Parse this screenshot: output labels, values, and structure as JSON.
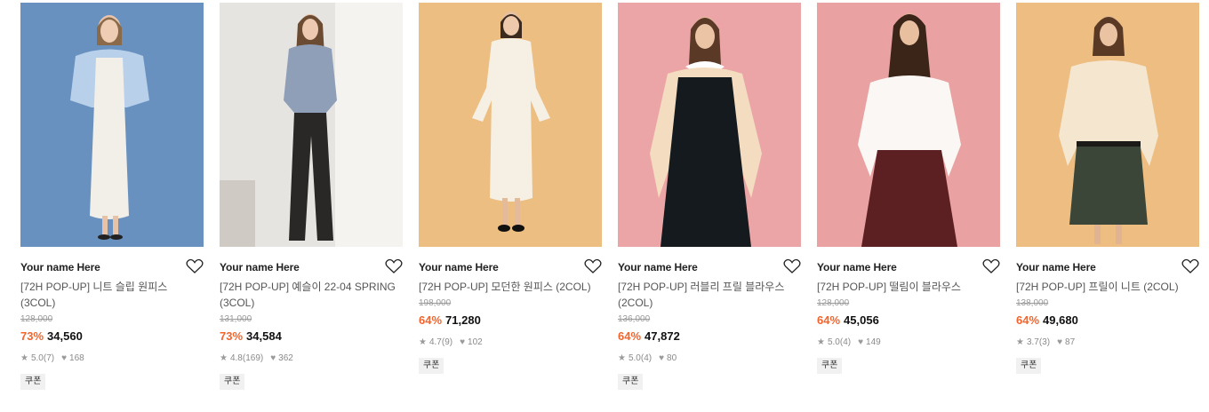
{
  "products": [
    {
      "brand": "Your name Here",
      "title": "[72H POP-UP] 니트 슬립 원피스 (3COL)",
      "original_price": "128,000",
      "discount": "73%",
      "price": "34,560",
      "rating": "5.0",
      "reviews": "(7)",
      "likes": "168",
      "coupon": "쿠폰",
      "bg_color": "#6f97c4",
      "wish_icon": "heart-outline-icon"
    },
    {
      "brand": "Your name Here",
      "title": "[72H POP-UP] 예슬이 22-04 SPRING (3COL)",
      "original_price": "131,000",
      "discount": "73%",
      "price": "34,584",
      "rating": "4.8",
      "reviews": "(169)",
      "likes": "362",
      "coupon": "쿠폰",
      "bg_color": "#e6e4e0",
      "wish_icon": "heart-outline-icon"
    },
    {
      "brand": "Your name Here",
      "title": "[72H POP-UP] 모던한 원피스 (2COL)",
      "original_price": "198,000",
      "discount": "64%",
      "price": "71,280",
      "rating": "4.7",
      "reviews": "(9)",
      "likes": "102",
      "coupon": "쿠폰",
      "bg_color": "#edbe82",
      "wish_icon": "heart-outline-icon"
    },
    {
      "brand": "Your name Here",
      "title": "[72H POP-UP] 러블리 프릴 블라우스 (2COL)",
      "original_price": "136,000",
      "discount": "64%",
      "price": "47,872",
      "rating": "5.0",
      "reviews": "(4)",
      "likes": "80",
      "coupon": "쿠폰",
      "bg_color": "#eca5a6",
      "wish_icon": "heart-outline-icon"
    },
    {
      "brand": "Your name Here",
      "title": "[72H POP-UP] 떨림이 블라우스",
      "original_price": "128,000",
      "discount": "64%",
      "price": "45,056",
      "rating": "5.0",
      "reviews": "(4)",
      "likes": "149",
      "coupon": "쿠폰",
      "bg_color": "#e9a1a2",
      "wish_icon": "heart-outline-icon"
    },
    {
      "brand": "Your name Here",
      "title": "[72H POP-UP] 프릴이 니트 (2COL)",
      "original_price": "138,000",
      "discount": "64%",
      "price": "49,680",
      "rating": "3.7",
      "reviews": "(3)",
      "likes": "87",
      "coupon": "쿠폰",
      "bg_color": "#eebd81",
      "wish_icon": "heart-outline-icon"
    }
  ],
  "icons": {
    "star": "★",
    "heart": "♥"
  },
  "colors": {
    "discount": "#f2652d",
    "coupon_bg": "#f1f1f1"
  }
}
